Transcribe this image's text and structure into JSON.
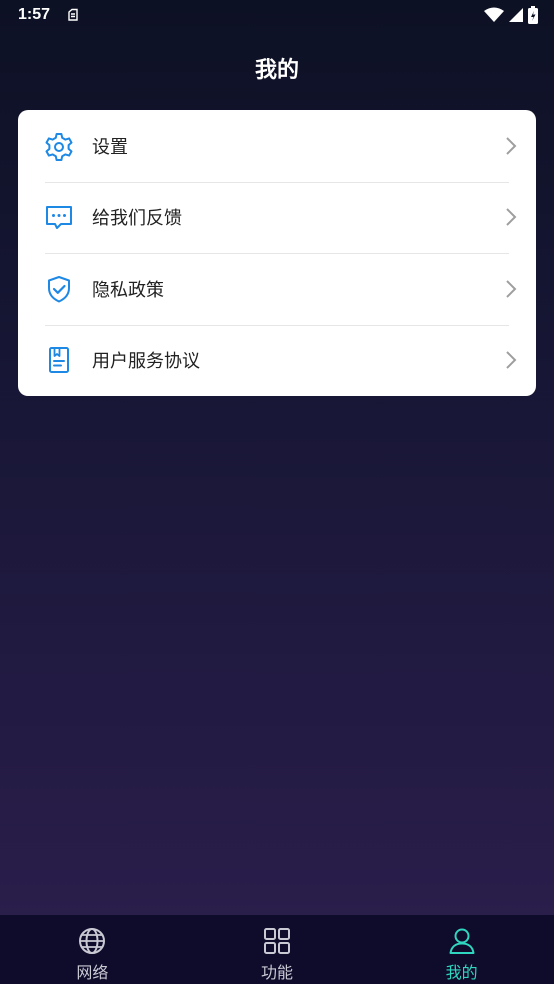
{
  "status_bar": {
    "time": "1:57",
    "notification_icon": "clipboard-icon",
    "right_icons": [
      "wifi-icon",
      "signal-icon",
      "battery-icon"
    ]
  },
  "page": {
    "title": "我的"
  },
  "menu": {
    "items": [
      {
        "label": "设置",
        "icon": "gear-icon"
      },
      {
        "label": "给我们反馈",
        "icon": "feedback-chat-icon"
      },
      {
        "label": "隐私政策",
        "icon": "shield-check-icon"
      },
      {
        "label": "用户服务协议",
        "icon": "document-icon"
      }
    ],
    "icon_color": "#1e88e5",
    "chevron_color": "#9e9e9e"
  },
  "tab_bar": {
    "items": [
      {
        "label": "网络",
        "icon": "globe-icon",
        "active": false
      },
      {
        "label": "功能",
        "icon": "grid-icon",
        "active": false
      },
      {
        "label": "我的",
        "icon": "user-icon",
        "active": true
      }
    ],
    "active_color": "#2fd6c0",
    "inactive_color": "#c9c9d4"
  }
}
